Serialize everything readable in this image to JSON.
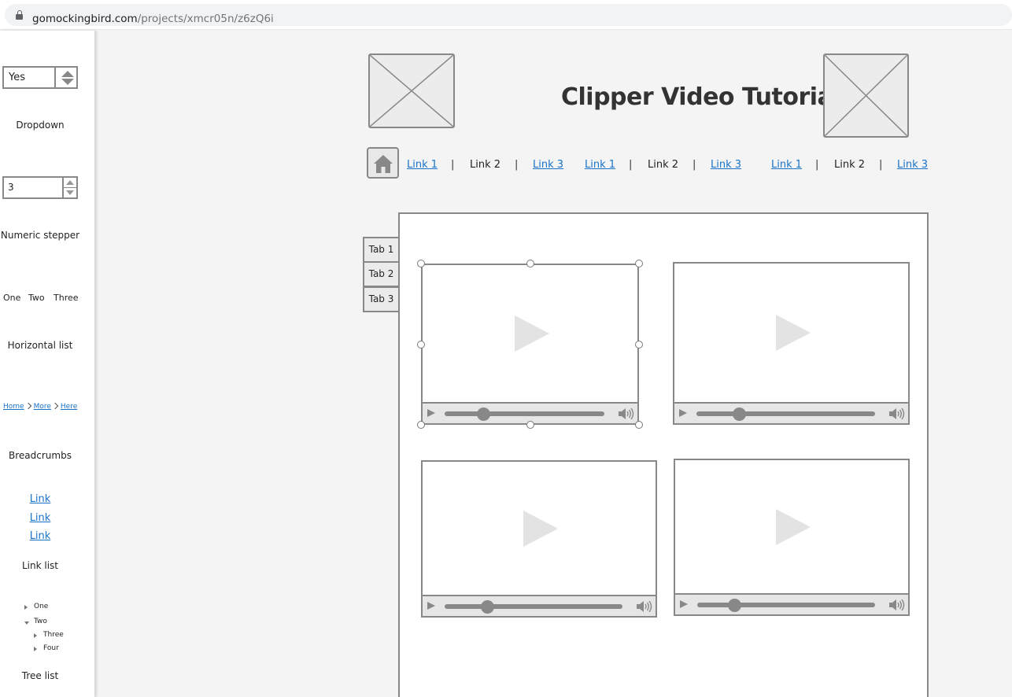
{
  "browser": {
    "url_domain": "gomockingbird.com",
    "url_path": "/projects/xmcr05n/z6zQ6i"
  },
  "palette": {
    "dropdown": {
      "value": "Yes",
      "label": "Dropdown"
    },
    "stepper": {
      "value": "3",
      "label": "Numeric stepper"
    },
    "horizontal_list": {
      "items": [
        "One",
        "Two",
        "Three"
      ],
      "label": "Horizontal list"
    },
    "breadcrumbs": {
      "items": [
        "Home",
        "More",
        "Here"
      ],
      "label": "Breadcrumbs"
    },
    "link_list": {
      "items": [
        "Link",
        "Link",
        "Link"
      ],
      "label": "Link list"
    },
    "tree_list": {
      "items": [
        "One",
        "Two",
        "Three",
        "Four"
      ],
      "label": "Tree list"
    }
  },
  "header": {
    "title": "Clipper Video Tutorials"
  },
  "nav": {
    "groups": [
      {
        "links": [
          "Link 1",
          "Link 2",
          "Link 3"
        ]
      },
      {
        "links": [
          "Link 1",
          "Link 2",
          "Link 3"
        ]
      },
      {
        "links": [
          "Link 1",
          "Link 2",
          "Link 3"
        ]
      }
    ],
    "separator": "|"
  },
  "tabs": [
    "Tab 1",
    "Tab 2",
    "Tab 3"
  ],
  "videos": [
    {
      "progress": 0.24,
      "selected": true
    },
    {
      "progress": 0.24,
      "selected": false
    },
    {
      "progress": 0.24,
      "selected": false
    },
    {
      "progress": 0.21,
      "selected": false
    }
  ],
  "colors": {
    "link": "#1a73c8",
    "wire_stroke": "#888888",
    "canvas_bg": "#f4f4f4"
  }
}
